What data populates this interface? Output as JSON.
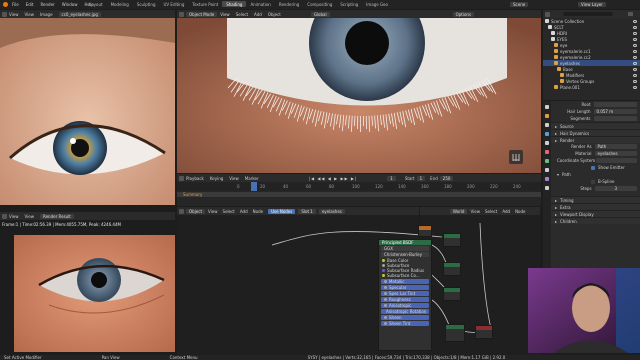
{
  "topbar": {
    "menus": [
      "File",
      "Edit",
      "Render",
      "Window",
      "Help"
    ],
    "workspaces": [
      "Layout",
      "Modeling",
      "Sculpting",
      "UV Editing",
      "Texture Paint",
      "Shading",
      "Animation",
      "Rendering",
      "Compositing",
      "Scripting",
      "Image Geo"
    ],
    "active_workspace": "Shading",
    "scene_label": "Scene",
    "view_layer_label": "View Layer"
  },
  "image_editor": {
    "menus": [
      "View",
      "View",
      "Image"
    ],
    "filename": "cc0_eyelashes.jpg"
  },
  "viewport": {
    "mode": "Object Mode",
    "menus": [
      "View",
      "Select",
      "Add",
      "Object"
    ],
    "transform": "Global",
    "shading_label": "Options"
  },
  "timeline": {
    "menus": [
      "Playback",
      "Keying",
      "View",
      "Marker"
    ],
    "current_frame": "1",
    "start_label": "Start",
    "start": "1",
    "end_label": "End",
    "end": "250",
    "ticks": [
      "0",
      "20",
      "40",
      "60",
      "80",
      "100",
      "120",
      "140",
      "160",
      "180",
      "200",
      "220",
      "240"
    ],
    "channel": "Summary"
  },
  "render_result": {
    "menus": [
      "View",
      "View"
    ],
    "title": "Render Result",
    "info": "Frame:1 | Time:02:56.39 | Mem:4055.75M, Peak: 4246.44M",
    "slot": "eyelashes"
  },
  "node_editor": {
    "menus": [
      "Object",
      "View",
      "Select",
      "Add",
      "Node"
    ],
    "use_nodes": "Use Nodes",
    "slot": "Slot 1",
    "material": "eyelashes",
    "main_node_title": "Principled BSDF",
    "node_rows": [
      "GGX",
      "Christensen-Burley",
      "Base Color",
      "Subsurface",
      "Subsurface Radius",
      "Subsurface Co...",
      "Metallic",
      "Specular",
      "Spec Lar Tint",
      "Roughness",
      "Anisotropic",
      "Anisotropic Rotation",
      "Sheen",
      "Sheen Tint"
    ],
    "small_menus": [
      "World",
      "View",
      "Select",
      "Add",
      "Node"
    ],
    "material_output": "eyelashes"
  },
  "outliner": {
    "title": "Scene Collection",
    "rows": [
      {
        "label": "Scene Collection",
        "selected": false
      },
      {
        "label": "SCLT",
        "selected": false
      },
      {
        "label": "HDRI",
        "selected": false
      },
      {
        "label": "EYES",
        "selected": false
      },
      {
        "label": "eye",
        "selected": false
      },
      {
        "label": "eyemalerie.cc1",
        "selected": false
      },
      {
        "label": "eyemalerie.cc2",
        "selected": false
      },
      {
        "label": "eyelashes",
        "selected": true
      },
      {
        "label": "Base",
        "selected": false
      },
      {
        "label": "Modifiers",
        "selected": false
      },
      {
        "label": "Vertex Groups",
        "selected": false
      },
      {
        "label": "Plane.001",
        "selected": false
      }
    ]
  },
  "properties": {
    "rows": [
      "Root",
      "Hair Length",
      "Segments"
    ],
    "values": [
      "",
      "0.057 m",
      ""
    ],
    "sections": [
      "Source",
      "Hair Dynamics",
      "Render"
    ],
    "render_as_label": "Render As",
    "render_as_value": "Path",
    "material_label": "Material",
    "material_value": "eyelashes",
    "coordinate_label": "Coordinate System",
    "show_emitter": "Show Emitter",
    "path_section": "Path",
    "bspline": "B-Spline",
    "steps_label": "Steps",
    "steps_value": "3",
    "more_sections": [
      "Timing",
      "Extra",
      "Viewport Display",
      "Children"
    ]
  },
  "statusbar": {
    "left": "Set Active Modifier",
    "mid1": "Pan View",
    "mid2": "Context Menu",
    "right": "SYSY | eyelashes | Verts:32,165 | Faces:59,734 | Tris:170,338 | Objects:1/8 | Mem:1.17 GiB | 2.92.0"
  },
  "colors": {
    "accent": "#4772b3",
    "shader_node_green": "#2c6b44",
    "input_socket_blue": "#4a64b8",
    "selected_row": "#334d80"
  }
}
